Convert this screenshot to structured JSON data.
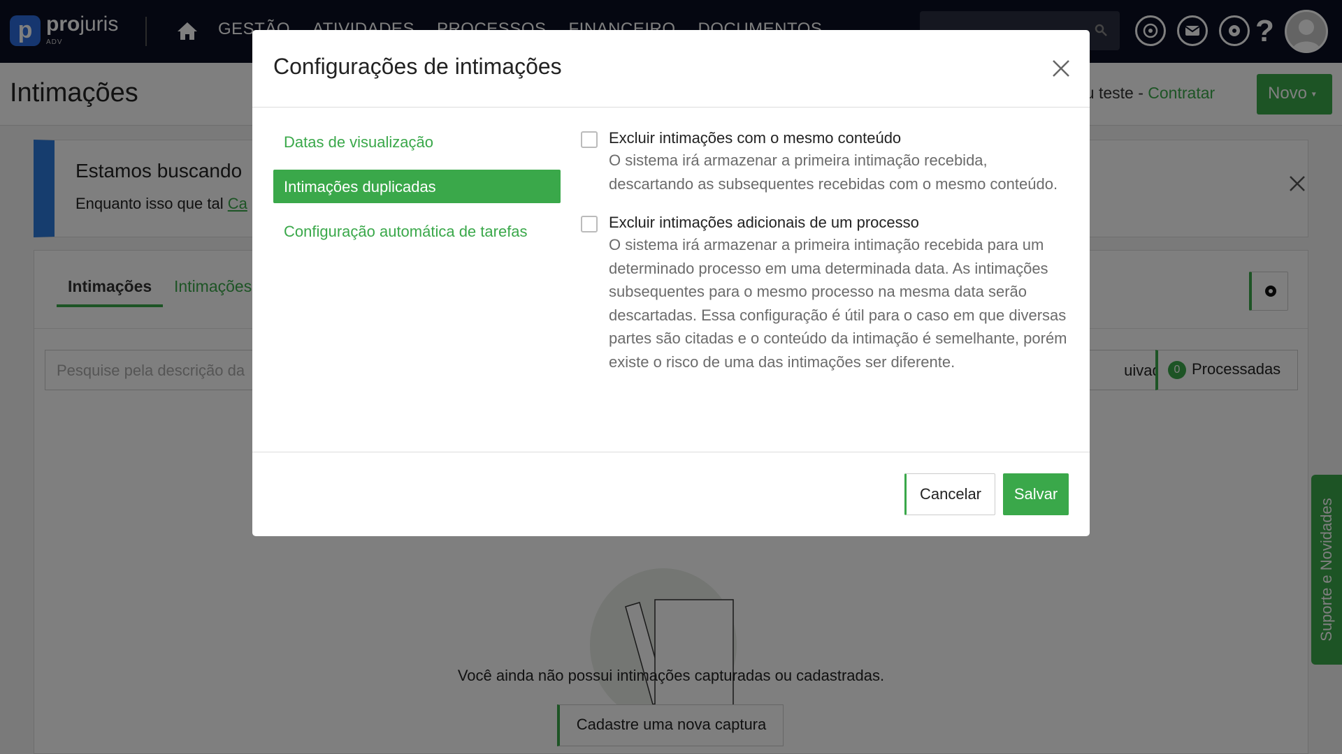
{
  "app": {
    "brand_bold": "pro",
    "brand_light": "juris",
    "brand_sub": "ADV",
    "logo_letter": "p",
    "nav": [
      "GESTÃO",
      "ATIVIDADES",
      "PROCESSOS",
      "FINANCEIRO",
      "DOCUMENTOS"
    ],
    "help_symbol": "?"
  },
  "page": {
    "title": "Intimações",
    "trial_text": "eu teste - ",
    "trial_link": "Contratar",
    "new_button": "Novo",
    "new_button_caret": "▾"
  },
  "banner": {
    "title": "Estamos buscando",
    "text": "Enquanto isso que tal ",
    "link": "Ca"
  },
  "content": {
    "tab_active": "Intimações",
    "tab_second": "Intimações",
    "search_placeholder": "Pesquise pela descrição da",
    "archived_label": "uivadas",
    "processed_count": "0",
    "processed_label": "Processadas",
    "empty_message": "Você ainda não possui intimações capturadas ou cadastradas.",
    "new_capture_button": "Cadastre uma nova captura"
  },
  "support_tab": "Suporte e Novidades",
  "modal": {
    "title": "Configurações de intimações",
    "menu": [
      {
        "label": "Datas de visualização",
        "active": false
      },
      {
        "label": "Intimações duplicadas",
        "active": true
      },
      {
        "label": "Configuração automática de tarefas",
        "active": false
      }
    ],
    "options": [
      {
        "title": "Excluir intimações com o mesmo conteúdo",
        "description": "O sistema irá armazenar a primeira intimação recebida, descartando as subsequentes recebidas com o mesmo conteúdo.",
        "checked": false
      },
      {
        "title": "Excluir intimações adicionais de um processo",
        "description": "O sistema irá armazenar a primeira intimação recebida para um determinado processo em uma determinada data. As intimações subsequentes para o mesmo processo na mesma data serão descartadas. Essa configuração é útil para o caso em que diversas partes são citadas e o conteúdo da intimação é semelhante, porém existe o risco de uma das intimações ser diferente.",
        "checked": false
      }
    ],
    "cancel_button": "Cancelar",
    "save_button": "Salvar"
  },
  "colors": {
    "accent_green": "#3aa84a",
    "topbar": "#0a0e22",
    "banner_accent": "#2d7bdc"
  },
  "icons": [
    "home-icon",
    "search-icon",
    "chat-icon",
    "mail-icon",
    "gear-icon",
    "help-icon",
    "user-avatar-icon",
    "close-icon",
    "settings-gear-icon"
  ]
}
